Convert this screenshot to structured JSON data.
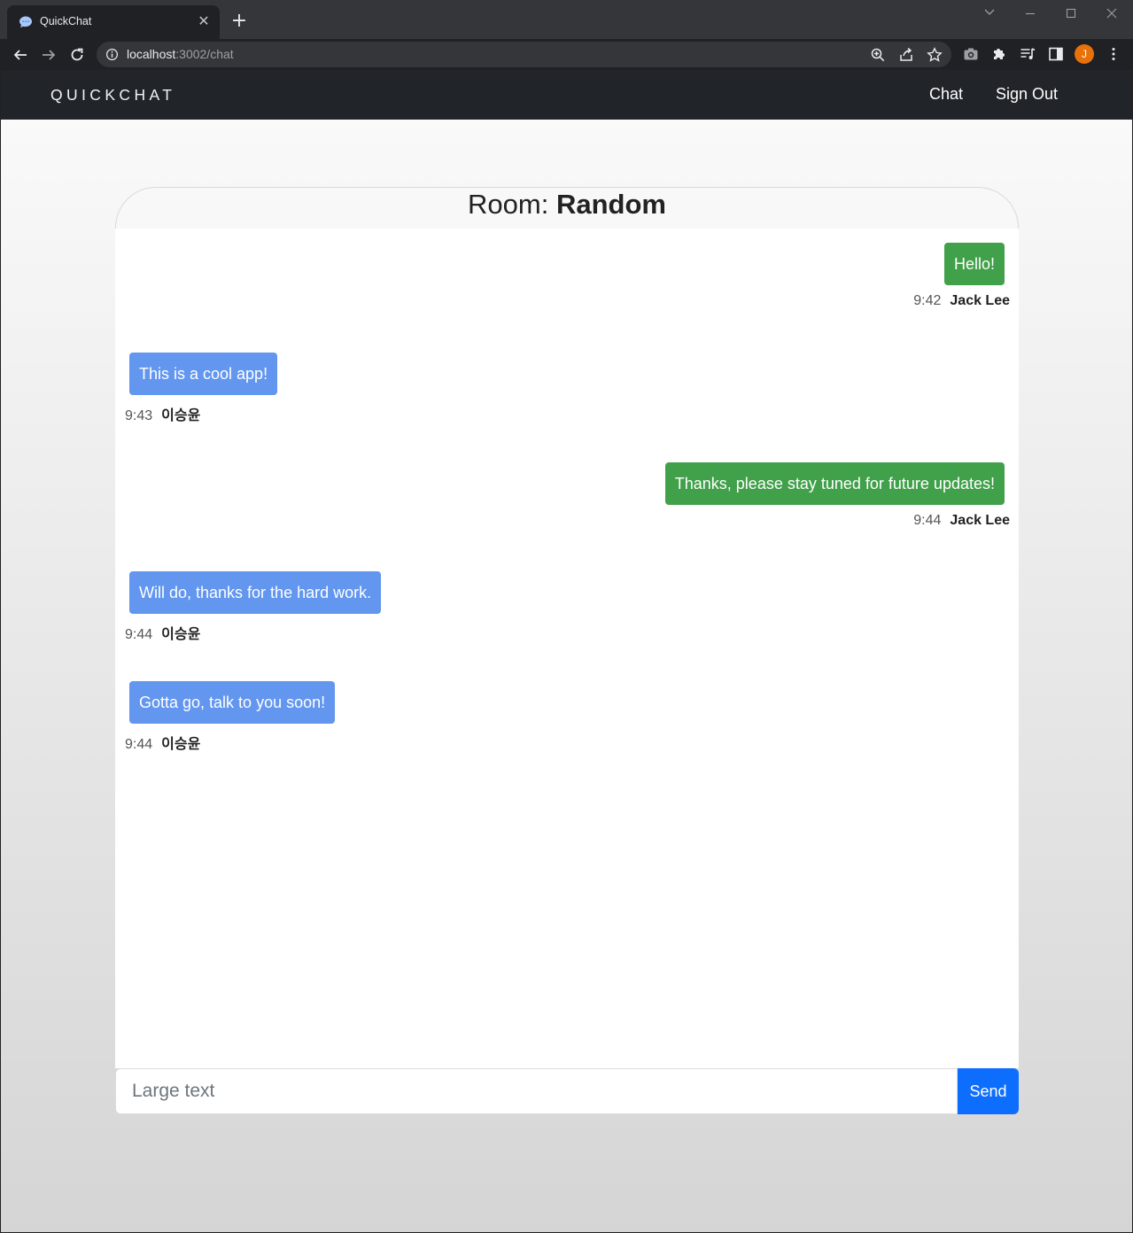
{
  "browser": {
    "tab_title": "QuickChat",
    "url_host": "localhost",
    "url_path": ":3002/chat",
    "profile_initial": "J"
  },
  "app": {
    "brand": "QUICKCHAT",
    "nav": {
      "chat": "Chat",
      "sign_out": "Sign Out"
    }
  },
  "room": {
    "prefix": "Room:",
    "name": "Random"
  },
  "messages": [
    {
      "text": "Hello!",
      "time": "9:42",
      "author": "Jack Lee",
      "side": "right"
    },
    {
      "text": "This is a cool app!",
      "time": "9:43",
      "author": "이승윤",
      "side": "left"
    },
    {
      "text": "Thanks, please stay tuned for future updates!",
      "time": "9:44",
      "author": "Jack Lee",
      "side": "right"
    },
    {
      "text": "Will do, thanks for the hard work.",
      "time": "9:44",
      "author": "이승윤",
      "side": "left"
    },
    {
      "text": "Gotta go, talk to you soon!",
      "time": "9:44",
      "author": "이승윤",
      "side": "left"
    }
  ],
  "composer": {
    "placeholder": "Large text",
    "send_label": "Send"
  },
  "colors": {
    "own_bubble": "#41a04a",
    "other_bubble": "#6296ef",
    "send_button": "#0d6efd",
    "navbar": "#212529"
  }
}
